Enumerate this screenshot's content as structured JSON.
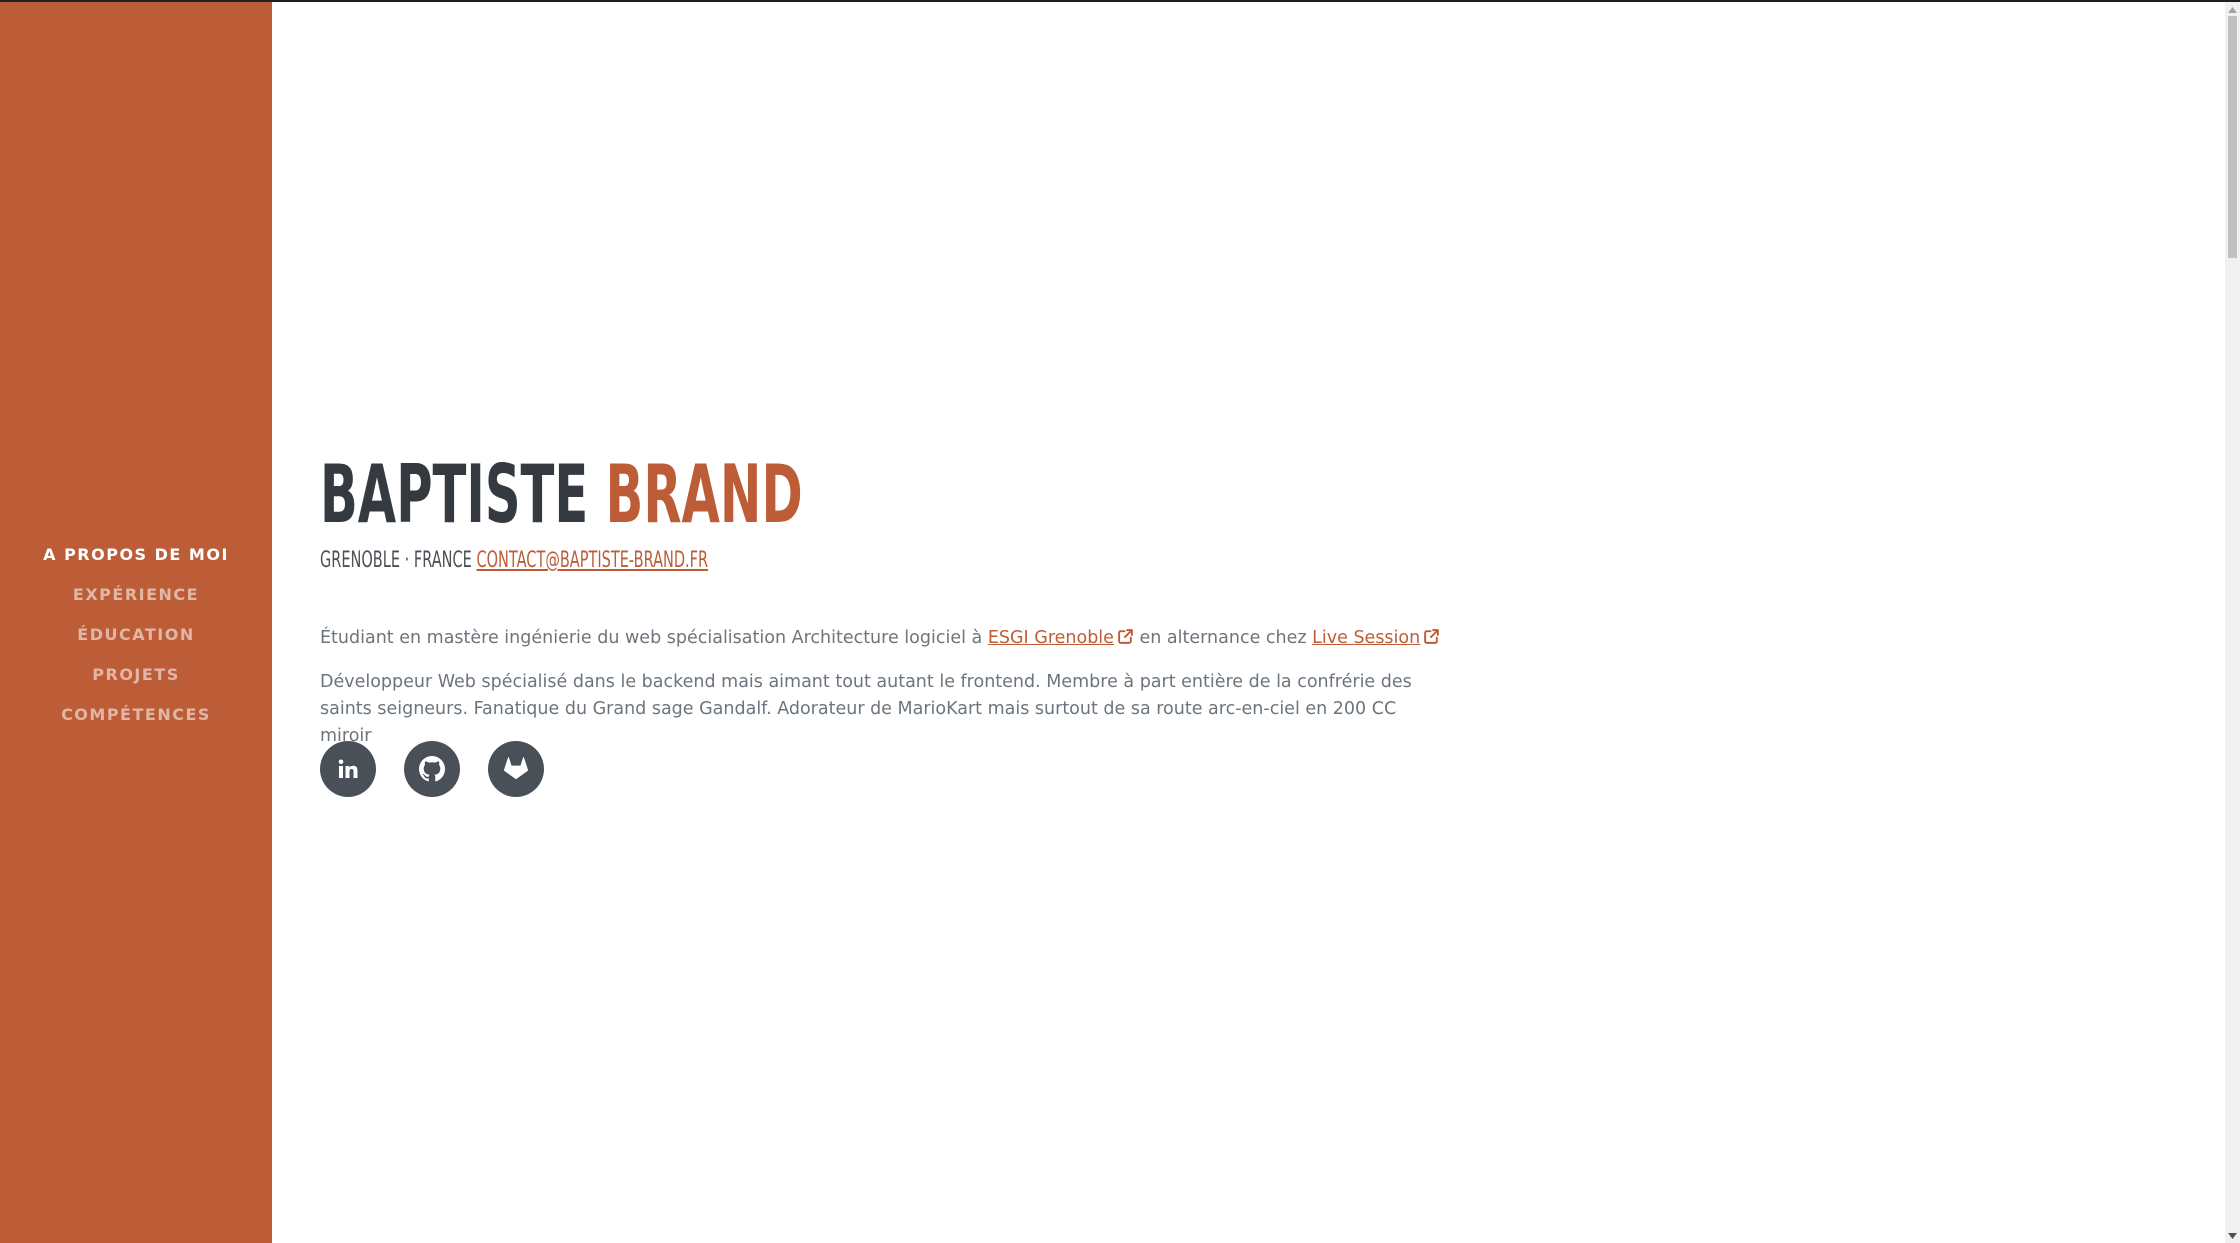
{
  "theme": {
    "primary": "#bd5d38",
    "dark_text": "#343a40",
    "muted_text": "#6c757d",
    "social_bg": "#495057"
  },
  "sidebar": {
    "items": [
      {
        "label": "A PROPOS DE MOI",
        "active": true
      },
      {
        "label": "EXPÉRIENCE",
        "active": false
      },
      {
        "label": "ÉDUCATION",
        "active": false
      },
      {
        "label": "PROJETS",
        "active": false
      },
      {
        "label": "COMPÉTENCES",
        "active": false
      }
    ]
  },
  "about": {
    "first_name": "BAPTISTE",
    "last_name": "BRAND",
    "location": "GRENOBLE · FRANCE",
    "email": "CONTACT@BAPTISTE-BRAND.FR",
    "intro_prefix": "Étudiant en mastère ingénierie du web spécialisation Architecture logiciel à",
    "school_link": "ESGI Grenoble",
    "intro_middle": "en alternance chez",
    "company_link": "Live Session",
    "bio": "Développeur Web spécialisé dans le backend mais aimant tout autant le frontend. Membre à part entière de la confrérie des saints seigneurs. Fanatique du Grand sage Gandalf. Adorateur de MarioKart mais surtout de sa route arc-en-ciel en 200 CC miroir"
  },
  "socials": [
    {
      "icon": "linkedin-icon"
    },
    {
      "icon": "github-icon"
    },
    {
      "icon": "gitlab-icon"
    }
  ]
}
